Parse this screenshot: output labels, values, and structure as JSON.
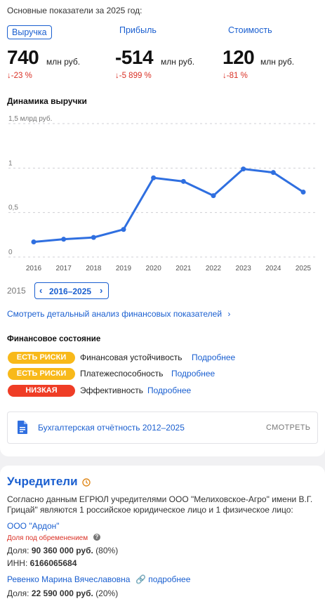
{
  "summary": {
    "intro": "Основные показатели за 2025 год:",
    "tabs": [
      "Выручка",
      "Прибыль",
      "Стоимость"
    ],
    "metrics": [
      {
        "value": "740",
        "unit": "млн руб.",
        "delta": "↓-23 %"
      },
      {
        "value": "-514",
        "unit": "млн руб.",
        "delta": "↓-5 899 %"
      },
      {
        "value": "120",
        "unit": "млн руб.",
        "delta": "↓-81 %"
      }
    ]
  },
  "chart_title": "Динамика выручки",
  "chart_data": {
    "type": "line",
    "x": [
      "2016",
      "2017",
      "2018",
      "2019",
      "2020",
      "2021",
      "2022",
      "2023",
      "2024",
      "2025"
    ],
    "series": [
      {
        "values": [
          0.17,
          0.2,
          0.22,
          0.31,
          0.89,
          0.85,
          0.69,
          0.99,
          0.95,
          0.73
        ]
      }
    ],
    "y_ticks": [
      "1,5 млрд руб.",
      "1",
      "0,5",
      "0"
    ],
    "y_tick_values": [
      1.5,
      1,
      0.5,
      0
    ],
    "ylim": [
      0,
      1.5
    ],
    "grid": true,
    "color": "#2f6fe0"
  },
  "year_range": {
    "left_label": "2015",
    "label": "2016–2025"
  },
  "detail_link": "Смотреть детальный анализ финансовых показателей",
  "financial_state": {
    "title": "Финансовое состояние",
    "rows": [
      {
        "badge": "ЕСТЬ РИСКИ",
        "label": "Финансовая устойчивость",
        "link": "Подробнее"
      },
      {
        "badge": "ЕСТЬ РИСКИ",
        "label": "Платежеспособность",
        "link": "Подробнее"
      },
      {
        "badge": "НИЗКАЯ",
        "label": "Эффективность",
        "link": "Подробнее"
      }
    ]
  },
  "reports": {
    "label": "Бухгалтерская отчётность 2012–2025",
    "action": "СМОТРЕТЬ"
  },
  "founders": {
    "title": "Учредители",
    "text_line1": "Согласно данным ЕГРЮЛ учредителями ООО \"Мелиховское-Агро\" имени В.Г.",
    "text_line2": "Грицай\" являются 1 российское юридическое лицо и 1 физическое лицо:",
    "f1_name": "ООО \"Ардон\"",
    "f1_note": "Доля под обременением",
    "share_label": "Доля:",
    "f1_share": "90 360 000 руб.",
    "f1_pct": "(80%)",
    "inn_label": "ИНН:",
    "f1_inn": "6166065684",
    "f2_name": "Ревенко Марина Вячеславовна",
    "f2_link": "подробнее",
    "f2_share": "22 590 000 руб.",
    "f2_pct": "(20%)"
  }
}
